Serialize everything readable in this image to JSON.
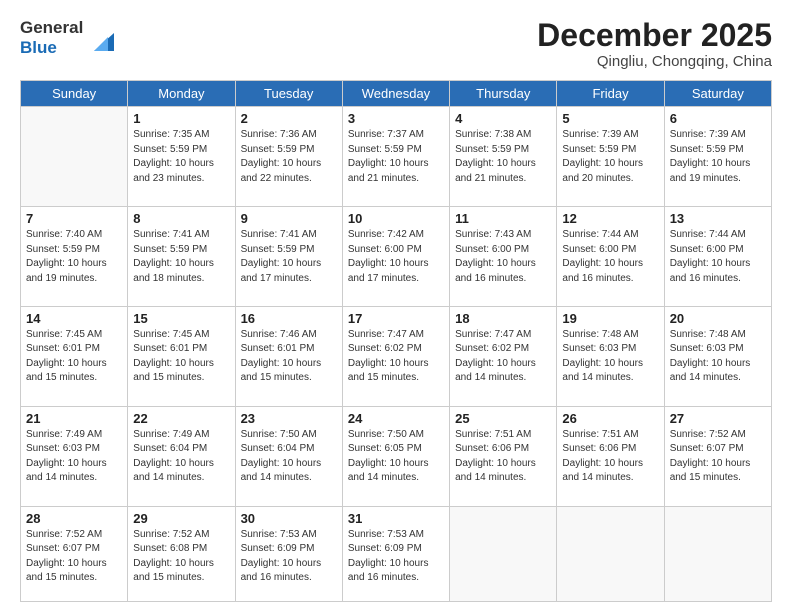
{
  "header": {
    "logo_line1": "General",
    "logo_line2": "Blue",
    "month": "December 2025",
    "location": "Qingliu, Chongqing, China"
  },
  "weekdays": [
    "Sunday",
    "Monday",
    "Tuesday",
    "Wednesday",
    "Thursday",
    "Friday",
    "Saturday"
  ],
  "weeks": [
    [
      {
        "day": "",
        "info": ""
      },
      {
        "day": "1",
        "info": "Sunrise: 7:35 AM\nSunset: 5:59 PM\nDaylight: 10 hours\nand 23 minutes."
      },
      {
        "day": "2",
        "info": "Sunrise: 7:36 AM\nSunset: 5:59 PM\nDaylight: 10 hours\nand 22 minutes."
      },
      {
        "day": "3",
        "info": "Sunrise: 7:37 AM\nSunset: 5:59 PM\nDaylight: 10 hours\nand 21 minutes."
      },
      {
        "day": "4",
        "info": "Sunrise: 7:38 AM\nSunset: 5:59 PM\nDaylight: 10 hours\nand 21 minutes."
      },
      {
        "day": "5",
        "info": "Sunrise: 7:39 AM\nSunset: 5:59 PM\nDaylight: 10 hours\nand 20 minutes."
      },
      {
        "day": "6",
        "info": "Sunrise: 7:39 AM\nSunset: 5:59 PM\nDaylight: 10 hours\nand 19 minutes."
      }
    ],
    [
      {
        "day": "7",
        "info": "Sunrise: 7:40 AM\nSunset: 5:59 PM\nDaylight: 10 hours\nand 19 minutes."
      },
      {
        "day": "8",
        "info": "Sunrise: 7:41 AM\nSunset: 5:59 PM\nDaylight: 10 hours\nand 18 minutes."
      },
      {
        "day": "9",
        "info": "Sunrise: 7:41 AM\nSunset: 5:59 PM\nDaylight: 10 hours\nand 17 minutes."
      },
      {
        "day": "10",
        "info": "Sunrise: 7:42 AM\nSunset: 6:00 PM\nDaylight: 10 hours\nand 17 minutes."
      },
      {
        "day": "11",
        "info": "Sunrise: 7:43 AM\nSunset: 6:00 PM\nDaylight: 10 hours\nand 16 minutes."
      },
      {
        "day": "12",
        "info": "Sunrise: 7:44 AM\nSunset: 6:00 PM\nDaylight: 10 hours\nand 16 minutes."
      },
      {
        "day": "13",
        "info": "Sunrise: 7:44 AM\nSunset: 6:00 PM\nDaylight: 10 hours\nand 16 minutes."
      }
    ],
    [
      {
        "day": "14",
        "info": "Sunrise: 7:45 AM\nSunset: 6:01 PM\nDaylight: 10 hours\nand 15 minutes."
      },
      {
        "day": "15",
        "info": "Sunrise: 7:45 AM\nSunset: 6:01 PM\nDaylight: 10 hours\nand 15 minutes."
      },
      {
        "day": "16",
        "info": "Sunrise: 7:46 AM\nSunset: 6:01 PM\nDaylight: 10 hours\nand 15 minutes."
      },
      {
        "day": "17",
        "info": "Sunrise: 7:47 AM\nSunset: 6:02 PM\nDaylight: 10 hours\nand 15 minutes."
      },
      {
        "day": "18",
        "info": "Sunrise: 7:47 AM\nSunset: 6:02 PM\nDaylight: 10 hours\nand 14 minutes."
      },
      {
        "day": "19",
        "info": "Sunrise: 7:48 AM\nSunset: 6:03 PM\nDaylight: 10 hours\nand 14 minutes."
      },
      {
        "day": "20",
        "info": "Sunrise: 7:48 AM\nSunset: 6:03 PM\nDaylight: 10 hours\nand 14 minutes."
      }
    ],
    [
      {
        "day": "21",
        "info": "Sunrise: 7:49 AM\nSunset: 6:03 PM\nDaylight: 10 hours\nand 14 minutes."
      },
      {
        "day": "22",
        "info": "Sunrise: 7:49 AM\nSunset: 6:04 PM\nDaylight: 10 hours\nand 14 minutes."
      },
      {
        "day": "23",
        "info": "Sunrise: 7:50 AM\nSunset: 6:04 PM\nDaylight: 10 hours\nand 14 minutes."
      },
      {
        "day": "24",
        "info": "Sunrise: 7:50 AM\nSunset: 6:05 PM\nDaylight: 10 hours\nand 14 minutes."
      },
      {
        "day": "25",
        "info": "Sunrise: 7:51 AM\nSunset: 6:06 PM\nDaylight: 10 hours\nand 14 minutes."
      },
      {
        "day": "26",
        "info": "Sunrise: 7:51 AM\nSunset: 6:06 PM\nDaylight: 10 hours\nand 14 minutes."
      },
      {
        "day": "27",
        "info": "Sunrise: 7:52 AM\nSunset: 6:07 PM\nDaylight: 10 hours\nand 15 minutes."
      }
    ],
    [
      {
        "day": "28",
        "info": "Sunrise: 7:52 AM\nSunset: 6:07 PM\nDaylight: 10 hours\nand 15 minutes."
      },
      {
        "day": "29",
        "info": "Sunrise: 7:52 AM\nSunset: 6:08 PM\nDaylight: 10 hours\nand 15 minutes."
      },
      {
        "day": "30",
        "info": "Sunrise: 7:53 AM\nSunset: 6:09 PM\nDaylight: 10 hours\nand 16 minutes."
      },
      {
        "day": "31",
        "info": "Sunrise: 7:53 AM\nSunset: 6:09 PM\nDaylight: 10 hours\nand 16 minutes."
      },
      {
        "day": "",
        "info": ""
      },
      {
        "day": "",
        "info": ""
      },
      {
        "day": "",
        "info": ""
      }
    ]
  ]
}
